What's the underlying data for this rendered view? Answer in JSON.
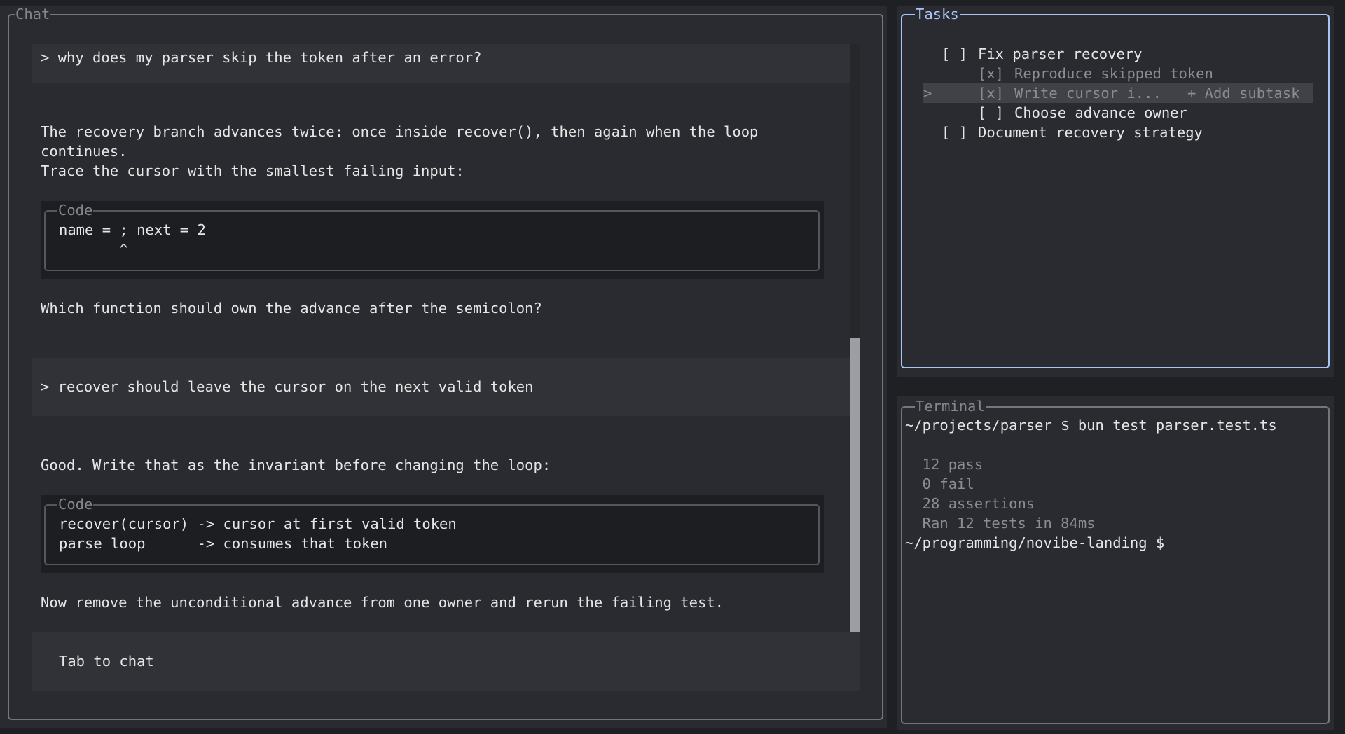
{
  "chat": {
    "title": "Chat",
    "messages": [
      {
        "role": "user",
        "text": "> why does my parser skip the token after an error?"
      },
      {
        "role": "assistant",
        "lines": [
          "The recovery branch advances twice: once inside recover(), then again when the loop",
          "continues.",
          "Trace the cursor with the smallest failing input:"
        ],
        "code": {
          "label": "Code",
          "lines": [
            "name = ; next = 2",
            "       ^"
          ]
        },
        "after": "Which function should own the advance after the semicolon?"
      },
      {
        "role": "user",
        "text": "> recover should leave the cursor on the next valid token"
      },
      {
        "role": "assistant",
        "lines": [
          "Good. Write that as the invariant before changing the loop:"
        ],
        "code": {
          "label": "Code",
          "lines": [
            "recover(cursor) -> cursor at first valid token",
            "parse loop      -> consumes that token"
          ]
        },
        "after": "Now remove the unconditional advance from one owner and rerun the failing test."
      }
    ],
    "input_hint": "Tab to chat",
    "scroll_position": 0.75
  },
  "tasks": {
    "title": "Tasks",
    "items": [
      {
        "checkbox": "[ ]",
        "label": "Fix parser recovery",
        "done": false,
        "level": 0,
        "selected": false
      },
      {
        "checkbox": "[x]",
        "label": "Reproduce skipped token",
        "done": true,
        "level": 1,
        "selected": false
      },
      {
        "checkbox": "[x]",
        "label": "Write cursor i...",
        "done": true,
        "level": 1,
        "selected": true,
        "action": "+ Add subtask"
      },
      {
        "checkbox": "[ ]",
        "label": "Choose advance owner",
        "done": false,
        "level": 1,
        "selected": false
      },
      {
        "checkbox": "[ ]",
        "label": "Document recovery strategy",
        "done": false,
        "level": 0,
        "selected": false
      }
    ],
    "cursor_marker": ">"
  },
  "terminal": {
    "title": "Terminal",
    "lines": [
      {
        "text": "~/projects/parser $ bun test parser.test.ts",
        "style": "prompt"
      },
      {
        "text": "",
        "style": "output"
      },
      {
        "text": "  12 pass",
        "style": "output"
      },
      {
        "text": "  0 fail",
        "style": "output"
      },
      {
        "text": "  28 assertions",
        "style": "output"
      },
      {
        "text": "  Ran 12 tests in 84ms",
        "style": "output"
      },
      {
        "text": "~/programming/novibe-landing $",
        "style": "prompt"
      }
    ]
  },
  "colors": {
    "background": "#1f2024",
    "pane": "#2a2b30",
    "user_message_bg": "#313237",
    "code_block_bg": "#1d1e21",
    "focus_border": "#a8c6f5",
    "text": "#e6e6e6",
    "muted_text": "#8c8d92"
  }
}
